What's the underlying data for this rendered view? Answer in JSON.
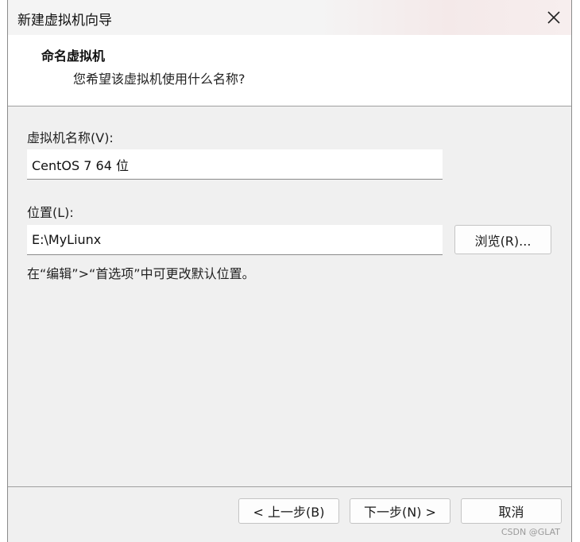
{
  "window": {
    "title": "新建虚拟机向导"
  },
  "header": {
    "title": "命名虚拟机",
    "subtitle": "您希望该虚拟机使用什么名称?"
  },
  "form": {
    "name_label": "虚拟机名称(V):",
    "name_value": "CentOS 7 64 位",
    "location_label": "位置(L):",
    "location_value": "E:\\MyLiunx",
    "browse_label": "浏览(R)...",
    "hint": "在“编辑”>“首选项”中可更改默认位置。"
  },
  "footer": {
    "back_label": "< 上一步(B)",
    "next_label": "下一步(N) >",
    "cancel_label": "取消"
  },
  "watermark": "CSDN @GLAT",
  "icons": {
    "close": "close-icon"
  }
}
